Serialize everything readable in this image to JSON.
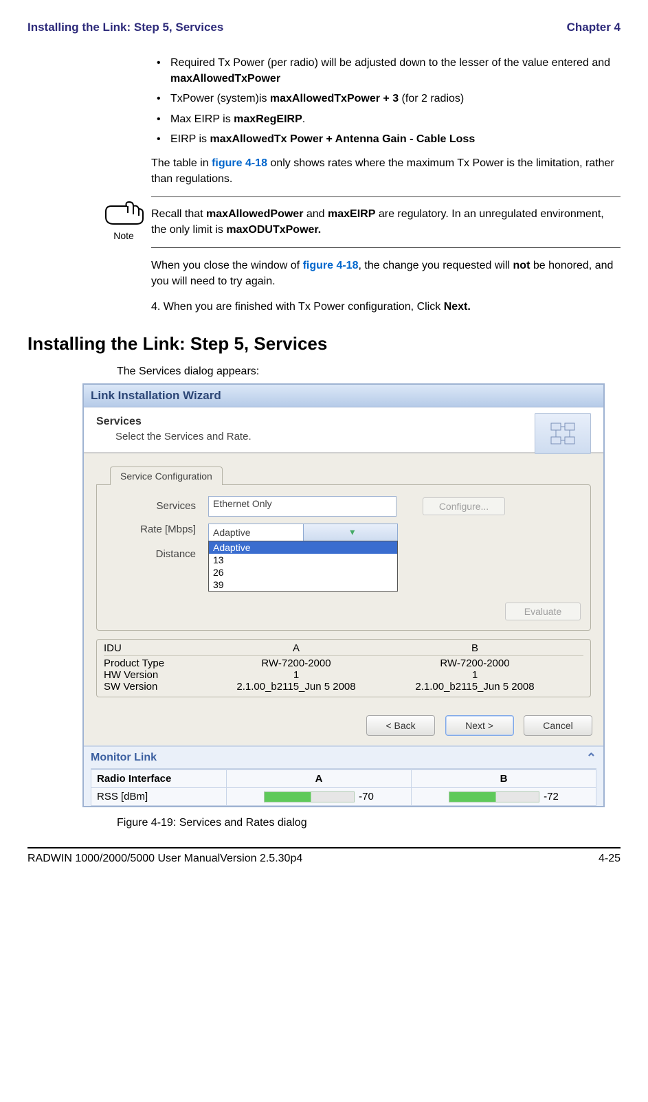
{
  "header": {
    "left": "Installing the Link: Step 5, Services",
    "right": "Chapter 4"
  },
  "bullets": {
    "b1a": "Required Tx Power (per radio) will be adjusted down to the lesser of the value entered and ",
    "b1b": "maxAllowedTxPower",
    "b2a": "TxPower (system)is ",
    "b2b": "maxAllowedTxPower + 3",
    "b2c": " (for 2 radios)",
    "b3a": "Max EIRP is ",
    "b3b": "maxRegEIRP",
    "b3c": ".",
    "b4a": "EIRP is ",
    "b4b": "maxAllowedTx Power + Antenna Gain - Cable Loss"
  },
  "paras": {
    "p1a": "The table in ",
    "p1link": "figure 4-18",
    "p1b": " only shows rates where the maximum Tx Power is the limitation, rather than regulations.",
    "note_a": "Recall that ",
    "note_b": "maxAllowedPower",
    "note_c": " and ",
    "note_d": "maxEIRP",
    "note_e": " are regulatory. In an unregulated environment, the only limit is ",
    "note_f": "maxODUTxPower.",
    "note_label": "Note",
    "p2a": "When you close the window of ",
    "p2link": "figure 4-18",
    "p2b": ", the change you requested will ",
    "p2not": "not",
    "p2c": " be honored, and you will need to try again.",
    "step4a": "4. When you are finished with Tx Power configuration, Click ",
    "step4b": "Next."
  },
  "section_head": "Installing the Link: Step 5, Services",
  "intro": "The Services dialog appears:",
  "wizard": {
    "title": "Link Installation Wizard",
    "svc_title": "Services",
    "svc_sub": "Select the Services and Rate.",
    "tab": "Service Configuration",
    "labels": {
      "services": "Services",
      "rate": "Rate [Mbps]",
      "distance": "Distance"
    },
    "services_value": "Ethernet Only",
    "rate_selected": "Adaptive",
    "rate_options": [
      "Adaptive",
      "13",
      "26",
      "39"
    ],
    "configure": "Configure...",
    "evaluate": "Evaluate",
    "idu": {
      "head": [
        "IDU",
        "A",
        "B"
      ],
      "rows": [
        [
          "Product Type",
          "RW-7200-2000",
          "RW-7200-2000"
        ],
        [
          "HW Version",
          "1",
          "1"
        ],
        [
          "SW Version",
          "2.1.00_b2115_Jun  5 2008",
          "2.1.00_b2115_Jun  5 2008"
        ]
      ]
    },
    "buttons": {
      "back": "< Back",
      "next": "Next >",
      "cancel": "Cancel"
    },
    "monitor_title": "Monitor Link",
    "monitor": {
      "head": [
        "Radio Interface",
        "A",
        "B"
      ],
      "row_label": "RSS [dBm]",
      "rss_a": "-70",
      "rss_b": "-72"
    }
  },
  "figure_caption": "Figure 4-19: Services and Rates dialog",
  "footer": {
    "left": "RADWIN 1000/2000/5000 User ManualVersion  2.5.30p4",
    "right": "4-25"
  }
}
